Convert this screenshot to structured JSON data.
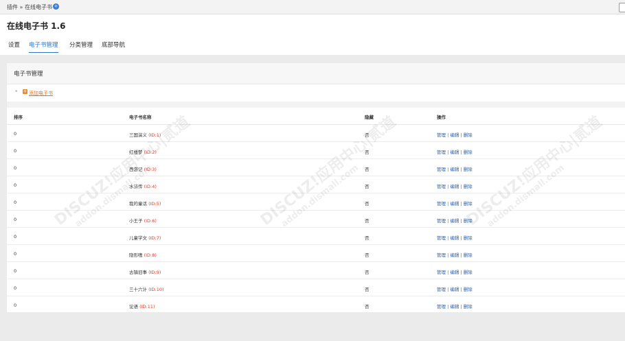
{
  "breadcrumb": {
    "parent": "插件",
    "separator": "»",
    "current": "在线电子书"
  },
  "page_title": "在线电子书 1.6",
  "tabs": [
    {
      "label": "设置",
      "active": false
    },
    {
      "label": "电子书管理",
      "active": true
    },
    {
      "label": "分类管理",
      "active": false
    },
    {
      "label": "底部导航",
      "active": false
    }
  ],
  "panel": {
    "title": "电子书管理",
    "add_marker": "*",
    "add_icon": "+",
    "add_label": "添加电子书"
  },
  "table": {
    "headers": {
      "order": "排序",
      "name": "电子书名称",
      "hidden": "隐藏",
      "actions": "操作"
    },
    "rows": [
      {
        "order": "0",
        "name": "三国演义",
        "id": "(ID:1)",
        "hidden": "否"
      },
      {
        "order": "0",
        "name": "红楼梦",
        "id": "(ID:2)",
        "hidden": "否"
      },
      {
        "order": "0",
        "name": "西游记",
        "id": "(ID:3)",
        "hidden": "否"
      },
      {
        "order": "0",
        "name": "水浒传",
        "id": "(ID:4)",
        "hidden": "否"
      },
      {
        "order": "0",
        "name": "我的童话",
        "id": "(ID:5)",
        "hidden": "否"
      },
      {
        "order": "0",
        "name": "小王子",
        "id": "(ID:6)",
        "hidden": "否"
      },
      {
        "order": "0",
        "name": "儿童学文",
        "id": "(ID:7)",
        "hidden": "否"
      },
      {
        "order": "0",
        "name": "隐形嗜",
        "id": "(ID:8)",
        "hidden": "否"
      },
      {
        "order": "0",
        "name": "古镇旧事",
        "id": "(ID:9)",
        "hidden": "否"
      },
      {
        "order": "0",
        "name": "三十六计",
        "id": "(ID:10)",
        "hidden": "否"
      },
      {
        "order": "0",
        "name": "论语",
        "id": "(ID:11)",
        "hidden": "否"
      }
    ],
    "actions": {
      "manage": "管理",
      "edit": "编辑",
      "delete": "删除",
      "separator": "|"
    }
  },
  "watermark": {
    "brand": "DISCUZ!应用中心|贰道",
    "domain": "addon.dismall.com"
  }
}
